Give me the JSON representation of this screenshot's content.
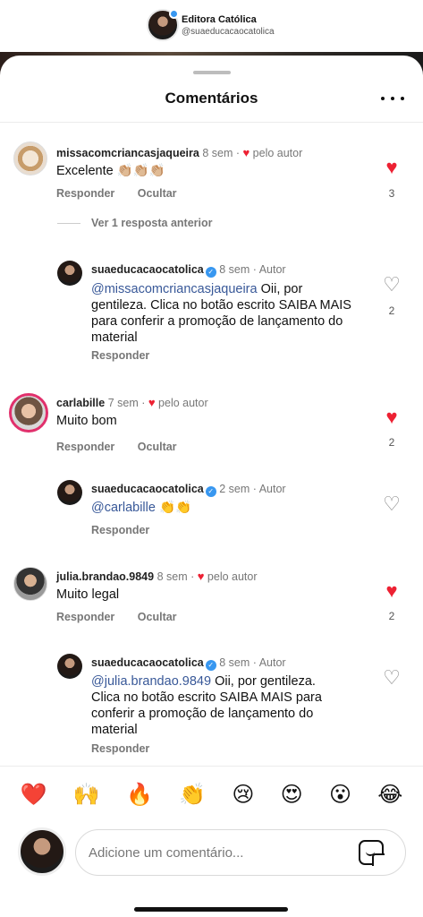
{
  "header": {
    "name": "Editora Católica",
    "handle": "@suaeducacaocatolica"
  },
  "sheet": {
    "title": "Comentários"
  },
  "comments": [
    {
      "username": "missacomcriancasjaqueira",
      "time": "8 sem",
      "liked_by_author": "pelo autor",
      "text": "Excelente 👏🏼👏🏼👏🏼",
      "reply_label": "Responder",
      "hide_label": "Ocultar",
      "likes": "3",
      "view_previous": "Ver 1 resposta anterior",
      "reply": {
        "username": "suaeducacaocatolica",
        "time": "8 sem",
        "role": "Autor",
        "mention": "@missacomcriancasjaqueira",
        "text": " Oii, por gentileza. Clica no botão escrito SAIBA MAIS para conferir a promoção de lançamento do material",
        "reply_label": "Responder",
        "likes": "2"
      }
    },
    {
      "username": "carlabille",
      "time": "7 sem",
      "liked_by_author": "pelo autor",
      "text": "Muito bom",
      "reply_label": "Responder",
      "hide_label": "Ocultar",
      "likes": "2",
      "reply": {
        "username": "suaeducacaocatolica",
        "time": "2 sem",
        "role": "Autor",
        "mention": "@carlabille",
        "text": " 👏👏",
        "reply_label": "Responder",
        "likes": ""
      }
    },
    {
      "username": "julia.brandao.9849",
      "time": "8 sem",
      "liked_by_author": "pelo autor",
      "text": "Muito legal",
      "reply_label": "Responder",
      "hide_label": "Ocultar",
      "likes": "2",
      "reply": {
        "username": "suaeducacaocatolica",
        "time": "8 sem",
        "role": "Autor",
        "mention": "@julia.brandao.9849",
        "text": " Oii, por gentileza. Clica no botão escrito SAIBA MAIS para conferir a promoção de lançamento do material",
        "reply_label": "Responder",
        "likes": ""
      }
    }
  ],
  "emoji_bar": [
    "❤️",
    "🙌",
    "🔥",
    "👏",
    "😢",
    "😍",
    "😮",
    "😂"
  ],
  "input": {
    "placeholder": "Adicione um comentário..."
  },
  "colors": {
    "like_red": "#ed2133",
    "mention_blue": "#385898",
    "verified_blue": "#3897f0"
  }
}
